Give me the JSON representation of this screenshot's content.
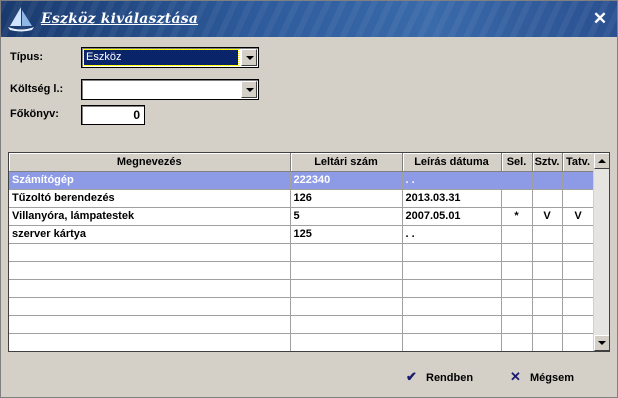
{
  "window": {
    "title": "Eszköz kiválasztása",
    "close_glyph": "✕",
    "logo_icon": "sailboat-logo-icon"
  },
  "form": {
    "type_label": "Típus:",
    "type_value": "Eszköz",
    "cost_label": "Költség l.:",
    "cost_value": "",
    "ledger_label": "Főkönyv:",
    "ledger_value": "0"
  },
  "table": {
    "headers": [
      "Megnevezés",
      "Leltári szám",
      "Leírás dátuma",
      "Sel.",
      "Sztv.",
      "Tatv."
    ],
    "rows": [
      {
        "name": "Számítógép",
        "inventory": "222340",
        "date": ". .",
        "sel": "",
        "sztv": "",
        "tatv": ""
      },
      {
        "name": "Tűzoltó berendezés",
        "inventory": "126",
        "date": "2013.03.31",
        "sel": "",
        "sztv": "",
        "tatv": ""
      },
      {
        "name": "Villanyóra, lámpatestek",
        "inventory": "5",
        "date": "2007.05.01",
        "sel": "*",
        "sztv": "V",
        "tatv": "V"
      },
      {
        "name": "szerver kártya",
        "inventory": "125",
        "date": ". .",
        "sel": "",
        "sztv": "",
        "tatv": ""
      }
    ],
    "selected_row": 0,
    "selection_color": "#8d9ae6"
  },
  "buttons": {
    "ok_label": "Rendben",
    "ok_icon": "check-icon",
    "cancel_label": "Mégsem",
    "cancel_icon": "x-icon"
  },
  "colors": {
    "title_bar": "#2d5a9a",
    "dialog_bg": "#d4d0c8",
    "combo_highlight": "#0a246a"
  }
}
